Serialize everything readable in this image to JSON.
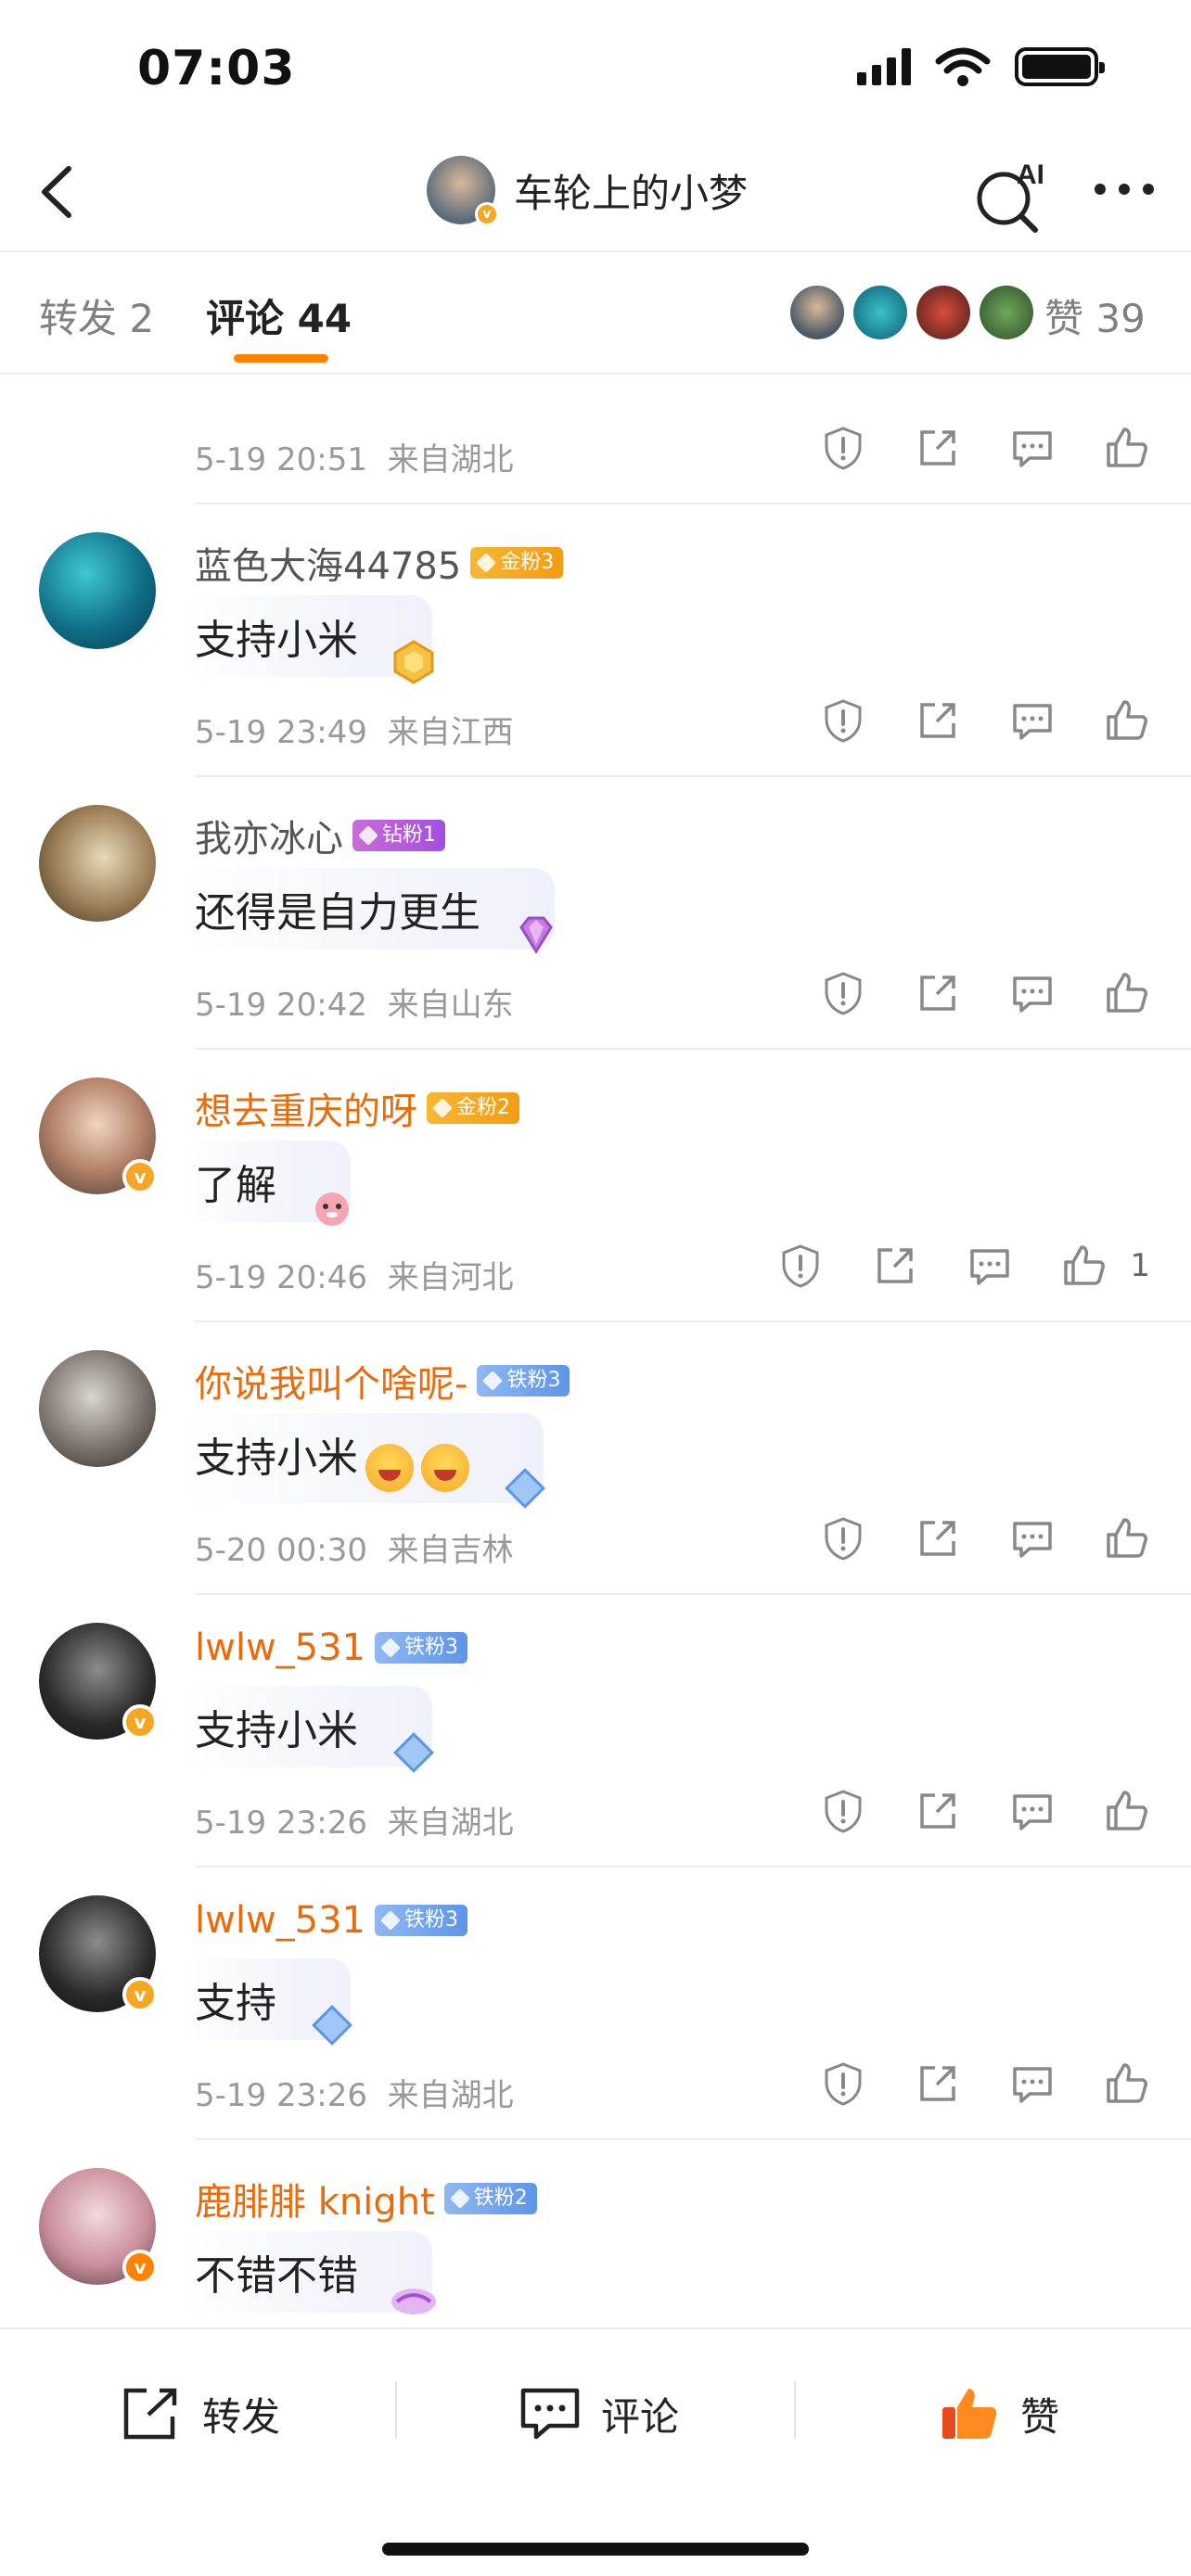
{
  "status": {
    "time": "07:03"
  },
  "nav": {
    "title": "车轮上的小梦",
    "ai_label": "AI"
  },
  "tabs": {
    "repost": "转发 2",
    "comment": "评论 44",
    "likes": "赞 39"
  },
  "first_meta": {
    "time": "5-19 20:51",
    "location": "来自湖北"
  },
  "comments": [
    {
      "name": "蓝色大海44785",
      "badge": "金粉3",
      "text": "支持小米",
      "time": "5-19 23:49",
      "location": "来自江西"
    },
    {
      "name": "我亦冰心",
      "badge": "钻粉1",
      "text": "还得是自力更生",
      "time": "5-19 20:42",
      "location": "来自山东"
    },
    {
      "name": "想去重庆的呀",
      "badge": "金粉2",
      "text": "了解",
      "time": "5-19 20:46",
      "location": "来自河北",
      "likes": "1"
    },
    {
      "name": "你说我叫个啥呢-",
      "badge": "铁粉3",
      "text": "支持小米",
      "time": "5-20 00:30",
      "location": "来自吉林"
    },
    {
      "name": "lwlw_531",
      "badge": "铁粉3",
      "text": "支持小米",
      "time": "5-19 23:26",
      "location": "来自湖北"
    },
    {
      "name": "lwlw_531",
      "badge": "铁粉3",
      "text": "支持",
      "time": "5-19 23:26",
      "location": "来自湖北"
    },
    {
      "name": "鹿腓腓 knight",
      "badge": "铁粉2",
      "text": "不错不错",
      "time": "",
      "location": ""
    }
  ],
  "bottom": {
    "repost": "转发",
    "comment": "评论",
    "like": "赞"
  },
  "colors": {
    "accent": "#ff8200",
    "name_orange": "#e86b0c"
  }
}
